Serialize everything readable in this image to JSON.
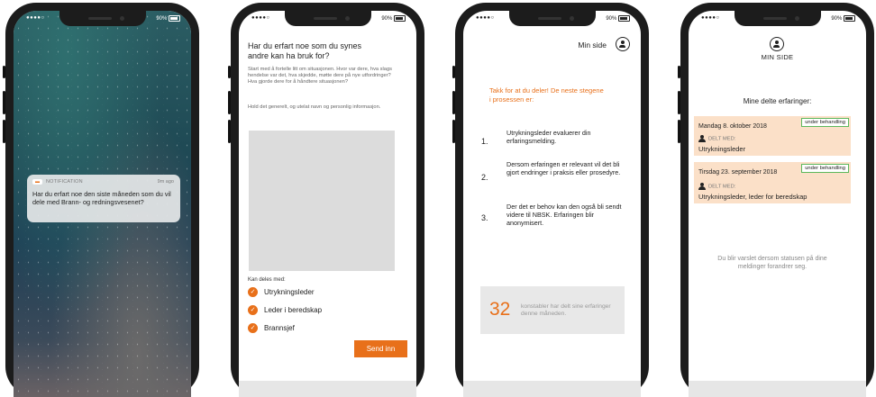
{
  "phone1": {
    "status": {
      "signal": "●●●●○",
      "battery": "90%"
    },
    "notification": {
      "app_label": "NOTIFICATION",
      "time": "9m ago",
      "message": "Har du erfart noe den siste måneden som du vil dele med Brann- og redningsvesenet?"
    }
  },
  "phone2": {
    "status": {
      "signal": "●●●●○",
      "battery": "90%"
    },
    "question": "Har du erfart noe som du synes andre kan ha bruk for?",
    "intro": "Start med å fortelle litt om situasjonen. Hvor var dere, hva slags hendelse var det, hva skjedde, møtte dere på nye utfordringer? Hva gjorde dere for å håndtere situasjonen?",
    "intro2": "Hold det generelt, og utelat navn og personlig informasjon.",
    "share_label": "Kan deles med:",
    "options": [
      "Utrykningsleder",
      "Leder i beredskap",
      "Brannsjef"
    ],
    "submit_label": "Send inn"
  },
  "phone3": {
    "status": {
      "signal": "●●●●○",
      "battery": "90%"
    },
    "header_link": "Min side",
    "thanks": "Takk for at du deler! De neste stegene i prosessen er:",
    "steps": [
      {
        "num": "1.",
        "text": "Utrykningsleder evaluerer din erfaringsmelding."
      },
      {
        "num": "2.",
        "text": "Dersom erfaringen er relevant vil det bli gjort endringer i praksis eller prosedyre."
      },
      {
        "num": "3.",
        "text": "Der det er behov kan den også bli sendt videre til NBSK. Erfaringen blir anonymisert."
      }
    ],
    "stat": {
      "number": "32",
      "label": "konstabler har delt sine erfaringer denne måneden."
    }
  },
  "phone4": {
    "status": {
      "signal": "●●●●○",
      "battery": "90%"
    },
    "title": "MIN SIDE",
    "heading": "Mine delte erfaringer:",
    "cards": [
      {
        "date": "Mandag 8. oktober 2018",
        "badge": "under behandling",
        "shared_label": "DELT MED:",
        "shared_with": "Utrykningsleder"
      },
      {
        "date": "Tirsdag 23. september 2018",
        "badge": "under behandling",
        "shared_label": "DELT MED:",
        "shared_with": "Utrykningsleder, leder for beredskap"
      }
    ],
    "notice": "Du blir varslet dersom statusen på dine meldinger forandrer seg."
  },
  "colors": {
    "accent": "#e8701a",
    "card_bg": "#fbe0c8",
    "badge_border": "#5cb85c"
  }
}
